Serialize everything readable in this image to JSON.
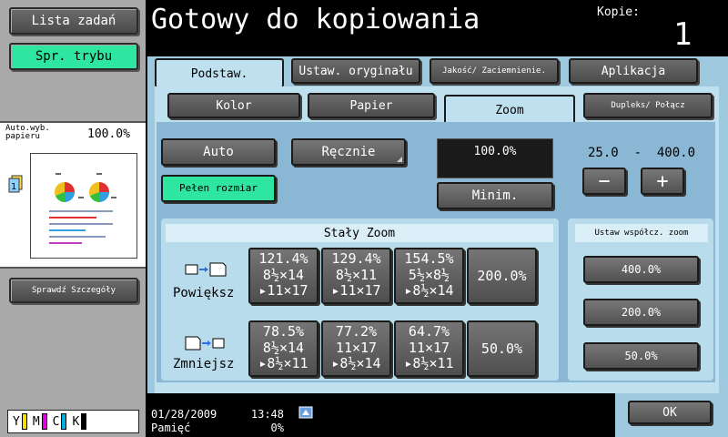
{
  "left": {
    "job_list": "Lista zadań",
    "mode_check": "Spr. trybu",
    "auto_paper": "Auto.wyb. papieru",
    "auto_percent": "100.0%",
    "check_details": "Sprawdź Szczegóły",
    "toner": [
      {
        "label": "Y",
        "color": "#f0e000"
      },
      {
        "label": "M",
        "color": "#e000e0"
      },
      {
        "label": "C",
        "color": "#00b0e0"
      },
      {
        "label": "K",
        "color": "#000000"
      }
    ]
  },
  "header": {
    "title": "Gotowy do kopiowania",
    "copies_label": "Kopie:",
    "copies_value": "1"
  },
  "tabs": {
    "basic": "Podstaw.",
    "original": "Ustaw. oryginału",
    "quality": "Jakość/ Zaciemnienie.",
    "application": "Aplikacja"
  },
  "subtabs": {
    "color": "Kolor",
    "paper": "Papier",
    "zoom": "Zoom",
    "duplex": "Dupleks/ Połącz"
  },
  "zoom": {
    "auto": "Auto",
    "manual": "Ręcznie",
    "full_size": "Pełen rozmiar",
    "current_value": "100.0%",
    "minimal": "Minim.",
    "range": "25.0  -  400.0",
    "minus": "−",
    "plus": "+",
    "fixed_header": "Stały Zoom",
    "enlarge_label": "Powiększ",
    "reduce_label": "Zmniejsz",
    "enlarge": [
      {
        "pct": "121.4%",
        "from": "8½×14",
        "to": "▸11×17"
      },
      {
        "pct": "129.4%",
        "from": "8½×11",
        "to": "▸11×17"
      },
      {
        "pct": "154.5%",
        "from": "5½×8½",
        "to": "▸8½×14"
      }
    ],
    "enlarge_single": "200.0%",
    "reduce": [
      {
        "pct": "78.5%",
        "from": "8½×14",
        "to": "▸8½×11"
      },
      {
        "pct": "77.2%",
        "from": "11×17",
        "to": "▸8½×14"
      },
      {
        "pct": "64.7%",
        "from": "11×17",
        "to": "▸8½×11"
      }
    ],
    "reduce_single": "50.0%",
    "preset_header": "Ustaw współcz. zoom",
    "presets": [
      "400.0%",
      "200.0%",
      "50.0%"
    ]
  },
  "footer": {
    "date": "01/28/2009",
    "time": "13:48",
    "memory_label": "Pamięć",
    "memory_value": "0%",
    "ok": "OK"
  }
}
